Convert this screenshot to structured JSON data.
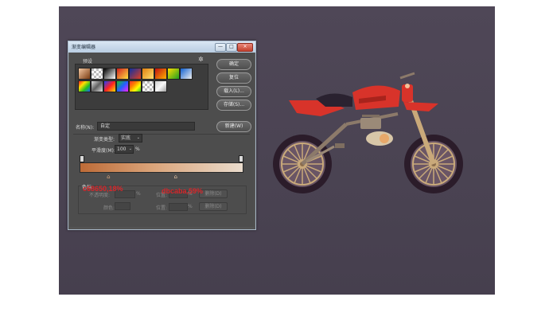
{
  "dialog": {
    "title": "渐变编辑器",
    "window_buttons": {
      "minimize": "—",
      "maximize": "□",
      "close": "×"
    },
    "presets_label": "预设",
    "presets_gear": "✲",
    "buttons": {
      "ok": "确定",
      "reset": "复位",
      "load": "载入(L)...",
      "save": "存储(S)...",
      "new": "新建(W)"
    },
    "name_label": "名称(N):",
    "name_value": "自定",
    "gradient_type_label": "渐变类型:",
    "gradient_type_value": "实底",
    "smoothness_label": "平滑度(M):",
    "smoothness_value": "100",
    "smoothness_unit": "%",
    "color_stops": {
      "title": "色标",
      "opacity_label": "不透明度:",
      "opacity_unit": "%",
      "location_label": "位置:",
      "location_unit": "%",
      "delete_label": "删除(D)",
      "color_label": "颜色:",
      "location2_label": "位置:",
      "location2_unit": "%",
      "delete2_label": "删除(D)"
    },
    "gradient": {
      "start_color": "#bd6b37",
      "mid_color": "#dba57b",
      "end_color": "#eadccd"
    },
    "stops": [
      {
        "location": 0.18,
        "color": "#d9a47a"
      },
      {
        "location": 0.59,
        "color": "#e3c2a3"
      }
    ]
  },
  "annotations": [
    {
      "text": "c68650,18%"
    },
    {
      "text": "dbcaba,59%"
    }
  ],
  "colors": {
    "canvas_bg": "#4a4352",
    "bike_body": "#d8332a",
    "tire": "#2b1c2a",
    "rim": "#c9a97a"
  }
}
